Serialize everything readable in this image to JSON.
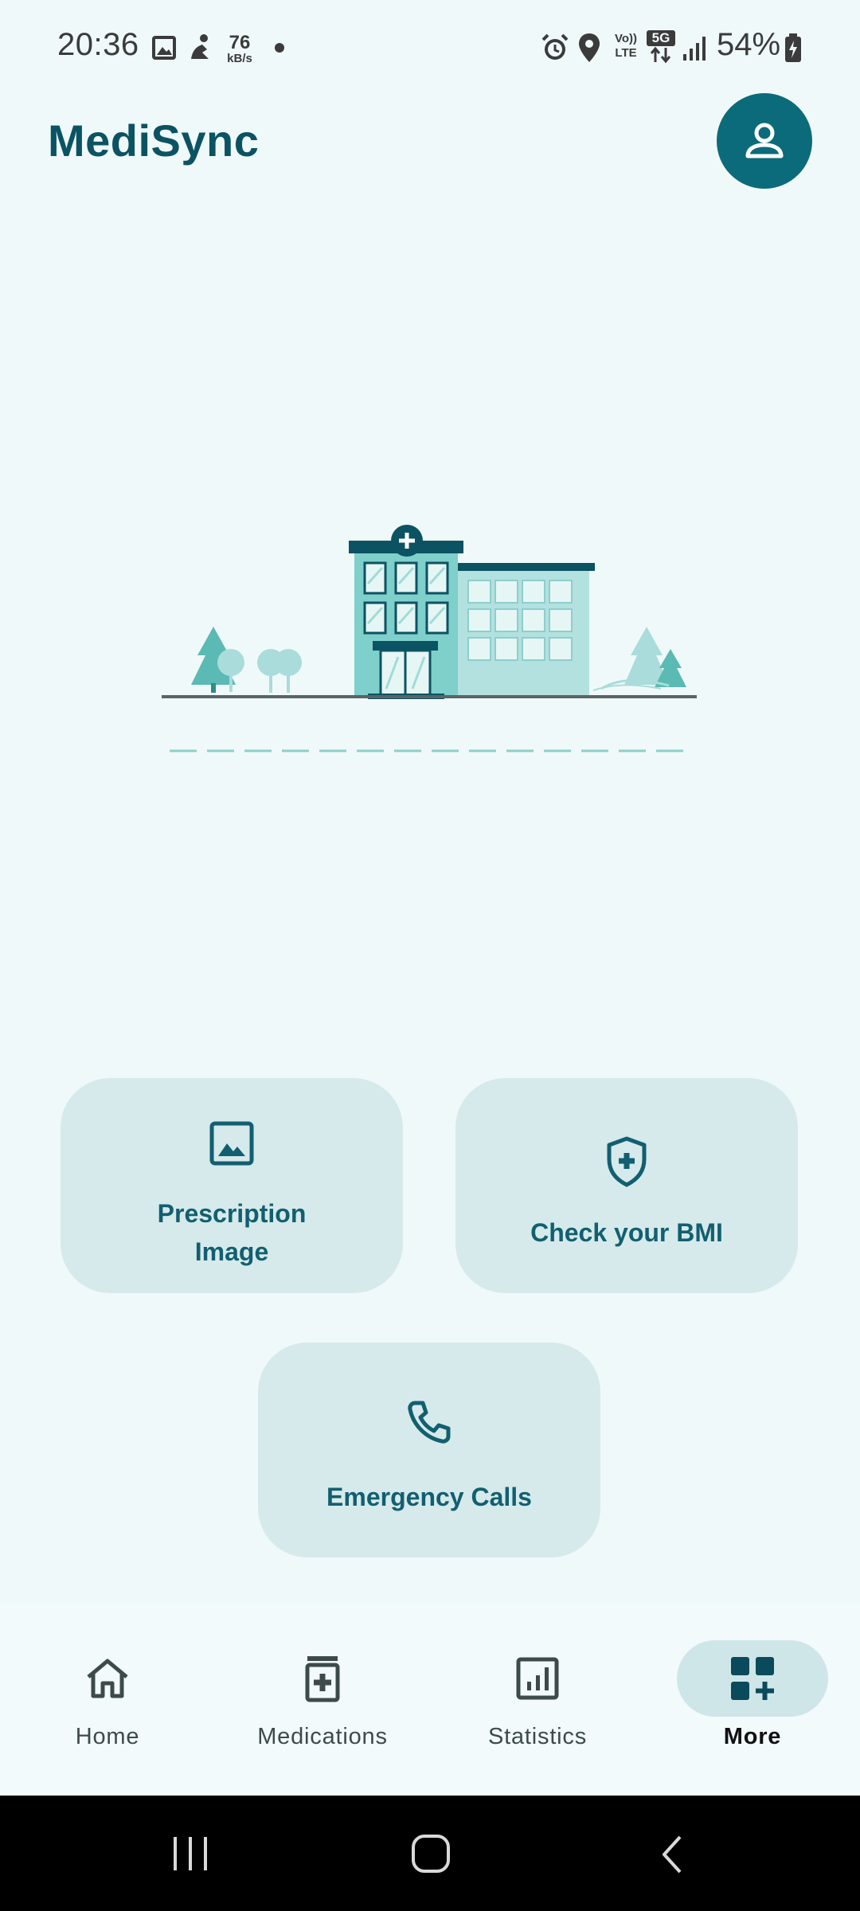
{
  "status_bar": {
    "time": "20:36",
    "speed_value": "76",
    "speed_unit": "kB/s",
    "battery": "54%",
    "network": "5G",
    "volte": "Vo)) LTE"
  },
  "app": {
    "title": "MediSync",
    "accent_color": "#0b6b7a"
  },
  "cards": [
    {
      "label_line1": "Prescription",
      "label_line2": "Image",
      "icon": "image-icon"
    },
    {
      "label": "Check your BMI",
      "icon": "shield-plus-icon"
    },
    {
      "label": "Emergency Calls",
      "icon": "phone-icon"
    }
  ],
  "bottom_nav": {
    "items": [
      {
        "label": "Home",
        "icon": "home-icon"
      },
      {
        "label": "Medications",
        "icon": "medication-icon"
      },
      {
        "label": "Statistics",
        "icon": "statistics-icon"
      },
      {
        "label": "More",
        "icon": "more-icon",
        "active": true
      }
    ]
  }
}
